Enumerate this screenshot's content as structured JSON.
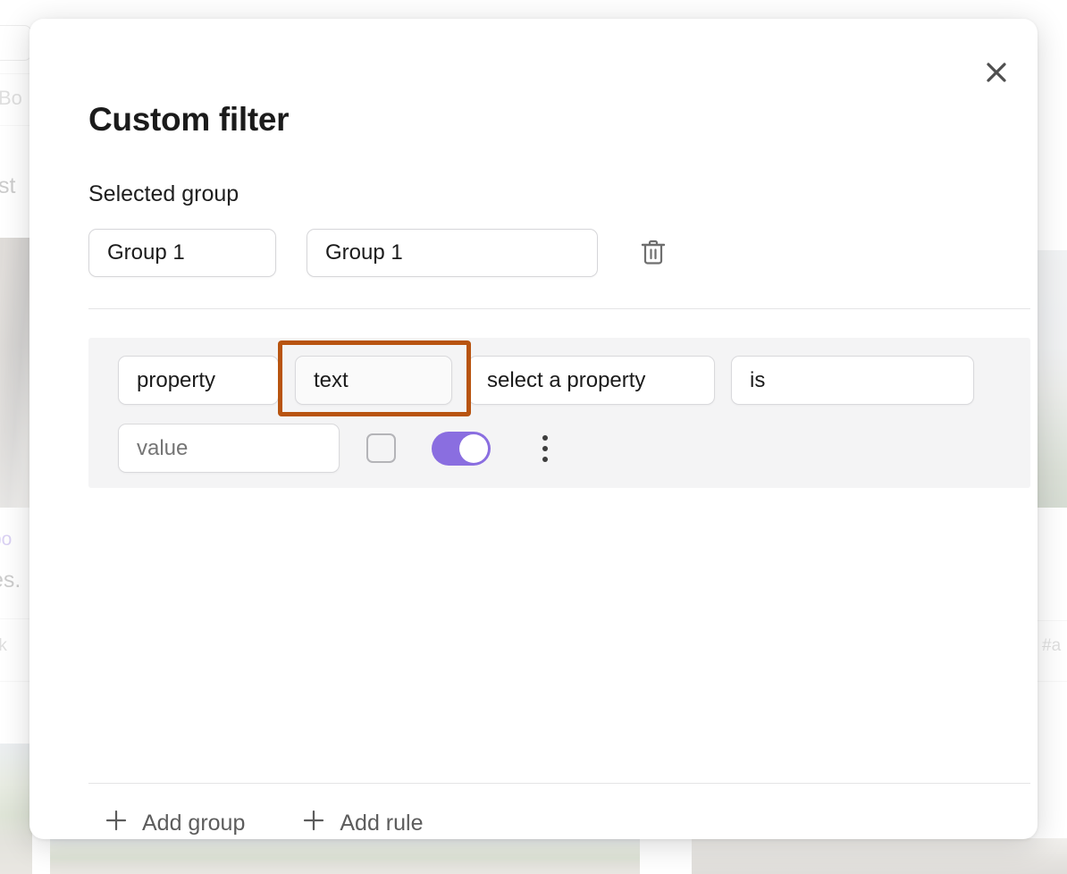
{
  "modal": {
    "title": "Custom filter",
    "close_icon": "close-icon",
    "section_label": "Selected group",
    "selected_group": {
      "group_select_value": "Group 1",
      "group_name_value": "Group 1",
      "delete_icon": "trash-icon"
    },
    "rule": {
      "property_type_value": "property",
      "value_type_value": "text",
      "property_select_value": "select a property",
      "operator_value": "is",
      "value_placeholder": "value",
      "checkbox_checked": false,
      "toggle_on": true,
      "more_icon": "kebab-menu-icon",
      "highlight_color": "#b85410",
      "toggle_color": "#8a6ee0",
      "panel_background": "#f4f4f5"
    },
    "footer": {
      "add_group_label": "Add group",
      "add_rule_label": "Add rule",
      "add_icon": "plus-icon"
    }
  },
  "background": {
    "truncated_label_1": "Bo",
    "truncated_label_2": "st",
    "truncated_link": "po",
    "truncated_text": "es.",
    "truncated_tag_left": "rk",
    "truncated_tag_right": "#a",
    "link_color": "#7c5cd6"
  }
}
